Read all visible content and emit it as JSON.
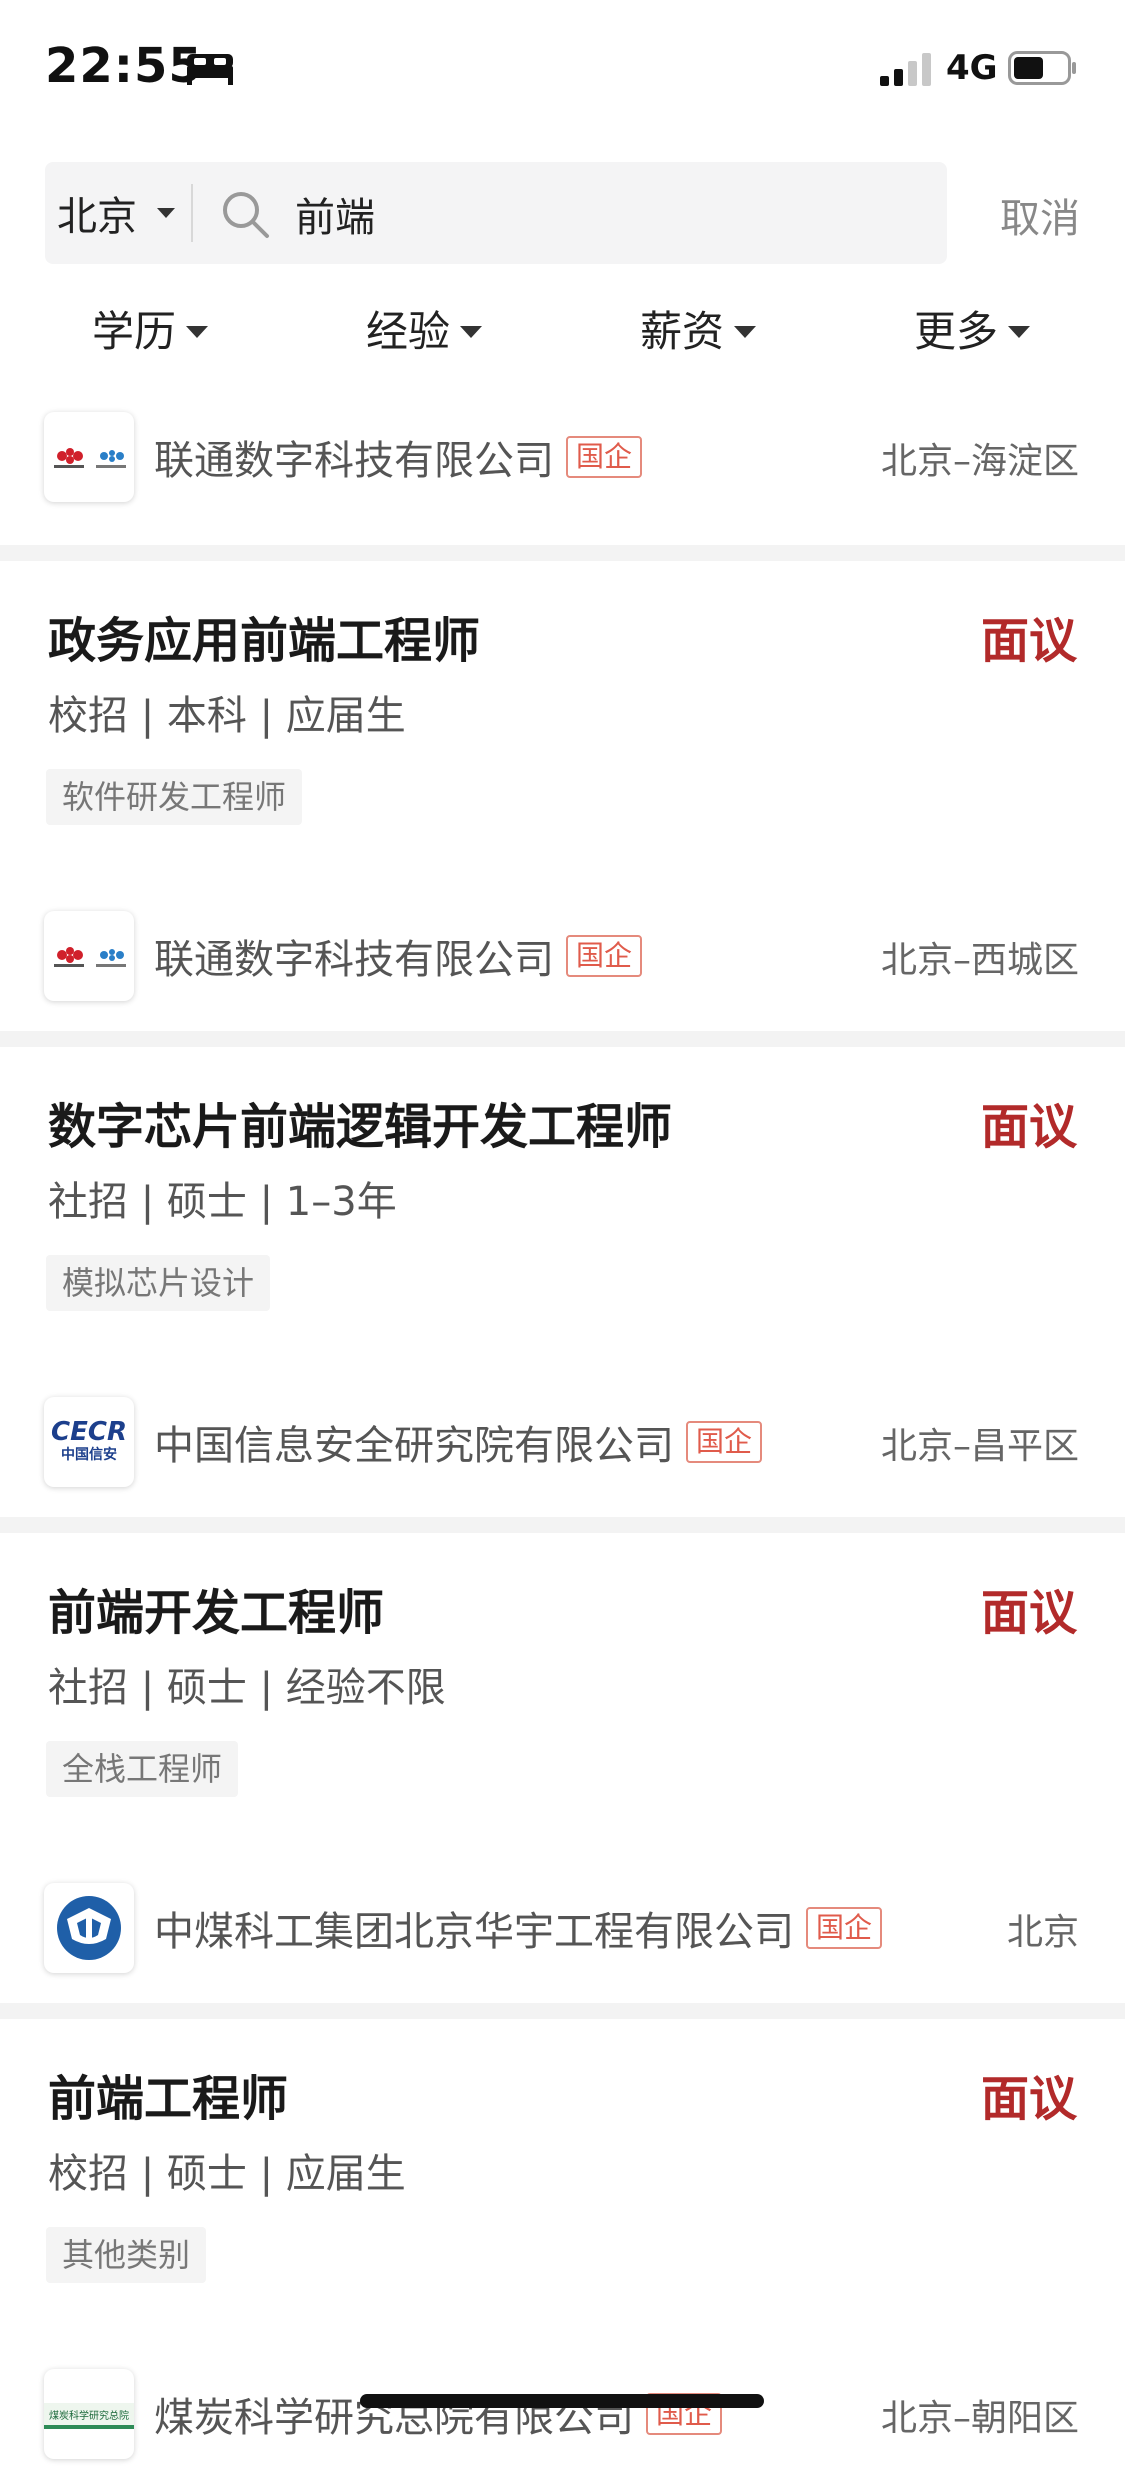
{
  "status_bar": {
    "time": "22:55",
    "network": "4G",
    "signal_bars_active": 2,
    "battery_level": 0.55
  },
  "search": {
    "city": "北京",
    "query": "前端",
    "cancel_label": "取消"
  },
  "filters": [
    {
      "label": "学历"
    },
    {
      "label": "经验"
    },
    {
      "label": "薪资"
    },
    {
      "label": "更多"
    }
  ],
  "partial_top": {
    "company": "联通数字科技有限公司",
    "badge": "国企",
    "location": "北京–海淀区",
    "logo": "china-unicom-logo"
  },
  "jobs": [
    {
      "title": "政务应用前端工程师",
      "salary": "面议",
      "meta": "校招 | 本科 | 应届生",
      "tag": "软件研发工程师",
      "company": "联通数字科技有限公司",
      "badge": "国企",
      "location": "北京–西城区",
      "logo": "china-unicom-logo"
    },
    {
      "title": "数字芯片前端逻辑开发工程师",
      "salary": "面议",
      "meta": "社招 | 硕士 | 1–3年",
      "tag": "模拟芯片设计",
      "company": "中国信息安全研究院有限公司",
      "badge": "国企",
      "location": "北京–昌平区",
      "logo": "cecr-logo",
      "logo_text": "CECR",
      "logo_subtext": "中国信安"
    },
    {
      "title": "前端开发工程师",
      "salary": "面议",
      "meta": "社招 | 硕士 | 经验不限",
      "tag": "全栈工程师",
      "company": "中煤科工集团北京华宇工程有限公司",
      "badge": "国企",
      "location": "北京",
      "logo": "ccteg-logo"
    },
    {
      "title": "前端工程师",
      "salary": "面议",
      "meta": "校招 | 硕士 | 应届生",
      "tag": "其他类别",
      "company": "煤炭科学研究总院有限公司",
      "badge": "国企",
      "location": "北京–朝阳区",
      "logo": "ccri-logo",
      "logo_text": "煤炭科学研究总院"
    }
  ],
  "colors": {
    "salary": "#b22a2a",
    "badge": "#e05b4b",
    "separator": "#f3f3f3",
    "search_bg": "#f4f4f5"
  }
}
